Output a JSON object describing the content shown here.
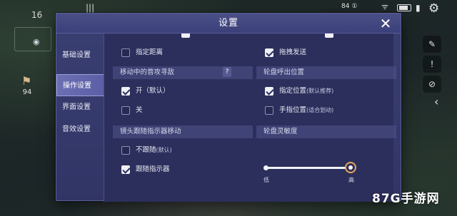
{
  "hud": {
    "fps": "16",
    "top_mid": "|||",
    "top_right": "84 ①",
    "score": "94",
    "wifi_icon": "wifi-icon",
    "signal_icon": "signal-icon",
    "gear_icon": "gear-icon"
  },
  "dialog": {
    "title": "设置",
    "close_icon": "close-icon"
  },
  "sidebar": {
    "items": [
      {
        "label": "基础设置"
      },
      {
        "label": "操作设置"
      },
      {
        "label": "界面设置"
      },
      {
        "label": "音效设置"
      }
    ],
    "active_index": 1
  },
  "left": {
    "specify_distance": {
      "label": "指定距离",
      "checked": false
    },
    "section_moving_attack": "移动中的普攻寻敌",
    "help_label": "?",
    "on_option": {
      "label": "开（默认）",
      "checked": true
    },
    "off_option": {
      "label": "关",
      "checked": false
    },
    "section_camera_follow": "镜头跟随指示器移动",
    "no_follow": {
      "label": "不跟随",
      "sub": "(默认)",
      "checked": false
    },
    "follow": {
      "label": "跟随指示器",
      "checked": true
    }
  },
  "right": {
    "drag_send": {
      "label": "拖拽发送",
      "checked": true
    },
    "section_wheel_position": "轮盘呼出位置",
    "specified_position": {
      "label": "指定位置",
      "sub": "(默认推荐)",
      "checked": true
    },
    "finger_position": {
      "label": "手指位置",
      "sub": "(适合划动)",
      "checked": false
    },
    "section_wheel_sensitivity": "轮盘灵敏度",
    "slider": {
      "min_label": "低",
      "max_label": "高",
      "value": 1.0
    }
  },
  "watermark": "87G手游网",
  "colors": {
    "panel": "#313566",
    "active_tab": "#5a5ea4",
    "accent": "#e6a85a"
  }
}
